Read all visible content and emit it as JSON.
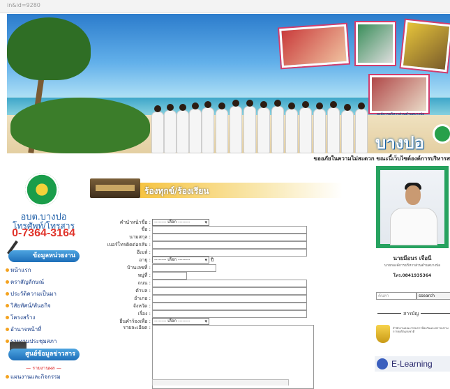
{
  "browser": {
    "url_fragment": "in&id=9280"
  },
  "banner": {
    "logo_text": "บางปอ",
    "logo_subtext": "องค์การบริหารส่วนตำบลบางปอ",
    "marquee_text": "ขออภัยในความไม่สะดวก ขณะนี้เว็บไซต์องค์การบริหารส"
  },
  "sidebar": {
    "org_name": "อบต.บางปอ",
    "phone_label": "โทรศัพท์/โทรสาร",
    "phone_number": "0-7364-3164",
    "menu_header_1": "ข้อมูลหน่วยงาน",
    "menu_items": [
      "หน้าแรก",
      "ตราสัญลักษณ์",
      "ประวัติความเป็นมา",
      "วิสัยทัศน์/พันธกิจ",
      "โครงสร้าง",
      "อำนาจหน้าที่",
      "รายงานประชุมสภา"
    ],
    "menu_header_2": "ศูนย์ข้อมูลข่าวสาร",
    "sub_label": "— รายงานผล —",
    "sub_item": "แผนงานและกิจกรรม"
  },
  "main": {
    "title": "ร้องทุกข์/ร้องเรียน",
    "fields": [
      {
        "label": "คำนำหน้าชื่อ :",
        "type": "select",
        "value": "-------- เลือก --------"
      },
      {
        "label": "ชื่อ :",
        "type": "text"
      },
      {
        "label": "นามสกุล :",
        "type": "text"
      },
      {
        "label": "เบอร์โทรติดต่อกลับ :",
        "type": "text"
      },
      {
        "label": "อีเมล์ :",
        "type": "text"
      },
      {
        "label": "อายุ :",
        "type": "select",
        "value": "-------- เลือก --------",
        "suffix": "ปี"
      },
      {
        "label": "บ้านเลขที่ :",
        "type": "text"
      },
      {
        "label": "หมู่ที่ :",
        "type": "text"
      },
      {
        "label": "ถนน :",
        "type": "text"
      },
      {
        "label": "ตำบล :",
        "type": "text"
      },
      {
        "label": "อำเภอ :",
        "type": "text"
      },
      {
        "label": "จังหวัด :",
        "type": "text"
      },
      {
        "label": "เรื่อง :",
        "type": "text"
      },
      {
        "label": "ยื่นคำร้องเพื่อ :",
        "type": "select",
        "value": "-------- เลือก --------"
      },
      {
        "label": "รายละเอียด :",
        "type": "textarea"
      }
    ]
  },
  "right": {
    "official_name": "นายมีอนร เจือนี",
    "official_position": "นายกองค์การบริหารส่วนตำบลบางปอ",
    "official_tel": "โทร.0841935364",
    "search_placeholder": "ค้นหา",
    "search_button": "ssearch",
    "category_label": "สารบัญ",
    "gov_text": "สำนักงานคณะกรรมการป้องกันและปราบปรามการทุจริตแห่งชาติ",
    "elearning_text": "E-Learning"
  }
}
